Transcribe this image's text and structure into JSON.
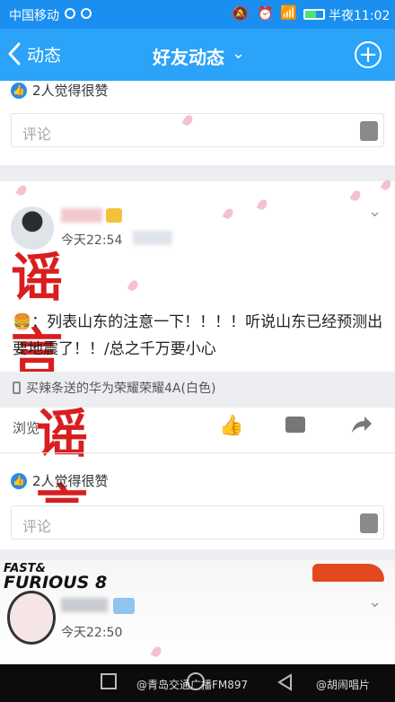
{
  "status_bar": {
    "carrier": "中国移动",
    "time": "半夜11:02"
  },
  "nav": {
    "back_label": "动态",
    "title": "好友动态",
    "dropdown_glyph": "⌄",
    "add_glyph": "+"
  },
  "post1": {
    "likes_text": "2人觉得很赞",
    "comment_placeholder": "评论"
  },
  "post2": {
    "time": "今天22:54",
    "content": "🍔：列表山东的注意一下！！！！听说山东已经预测出要地震了！！/总之千万要小心",
    "device": "买辣条送的华为荣耀荣耀4A(白色)",
    "views_label": "浏览",
    "likes_text": "2人觉得很赞",
    "comment_placeholder": "评论",
    "rumor_stamp_1": "谣　言",
    "rumor_stamp_2": "谣　言"
  },
  "post3": {
    "banner_text_1": "FAST&",
    "banner_text_2": "FURIOUS 8",
    "time": "今天22:50"
  },
  "watermark": {
    "left": "@青岛交通广播FM897",
    "right": "@胡闹唱片"
  },
  "colors": {
    "nav": "#2aa3f8",
    "status": "#1a8ff0",
    "rumor": "#d81e1e",
    "like": "#2a8be6"
  }
}
